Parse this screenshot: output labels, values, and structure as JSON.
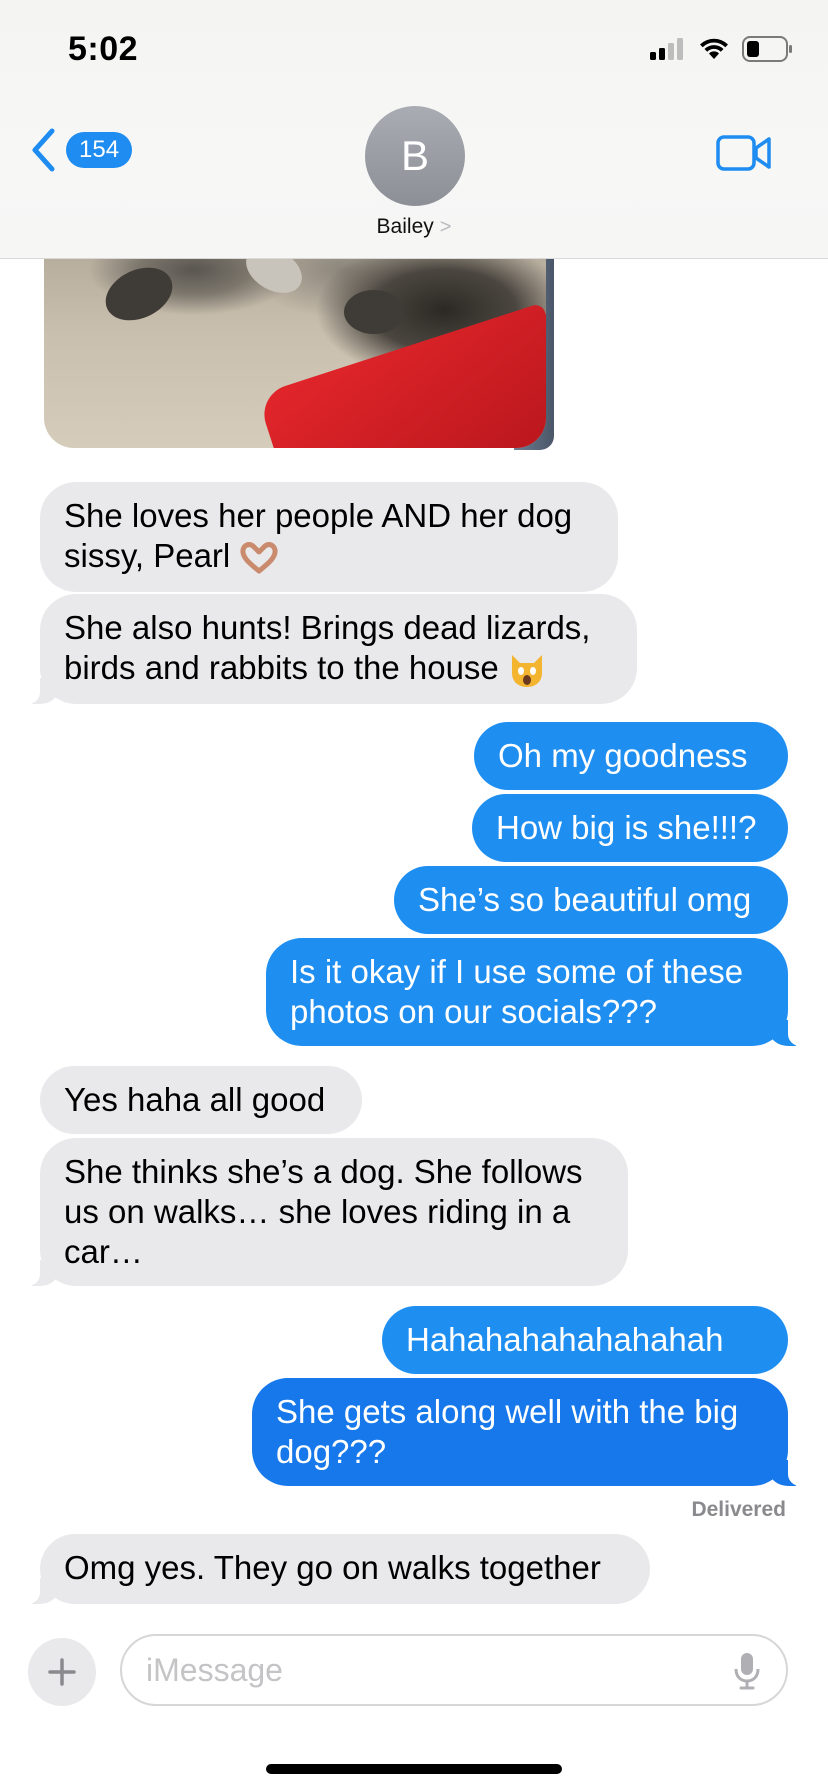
{
  "status_bar": {
    "time": "5:02"
  },
  "header": {
    "back_count": "154",
    "avatar_initial": "B",
    "contact_name": "Bailey",
    "chevron": ">"
  },
  "messages": [
    {
      "from": "them",
      "text": "She loves her people AND her dog sissy, Pearl",
      "emoji": "heart-hands"
    },
    {
      "from": "them",
      "text": "She also hunts! Brings dead lizards, birds and rabbits to the house",
      "emoji": "screaming-cat"
    },
    {
      "from": "me",
      "text": "Oh my goodness"
    },
    {
      "from": "me",
      "text": "How big is she!!!?"
    },
    {
      "from": "me",
      "text": "She’s so beautiful omg"
    },
    {
      "from": "me",
      "text": "Is it okay if I use some of these photos on our socials???"
    },
    {
      "from": "them",
      "text": "Yes haha all good"
    },
    {
      "from": "them",
      "text": "She thinks she’s a dog. She follows us on walks… she loves riding in a car…"
    },
    {
      "from": "me",
      "text": "Hahahahahahahahah"
    },
    {
      "from": "me",
      "text": "She gets along well with the big dog???"
    },
    {
      "from": "them",
      "text": "Omg yes. They go on walks together"
    }
  ],
  "delivered_label": "Delivered",
  "input": {
    "placeholder": "iMessage"
  },
  "icons": {
    "back": "chevron-left-icon",
    "video": "video-camera-icon",
    "plus": "plus-icon",
    "mic": "microphone-icon"
  },
  "colors": {
    "accent": "#1f8ef1",
    "incoming": "#e9e9eb",
    "badge": "#1e8cf0"
  }
}
